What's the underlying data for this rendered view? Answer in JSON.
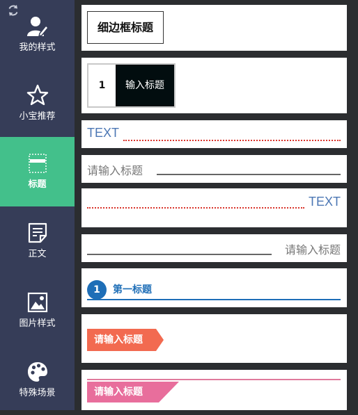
{
  "sidebar": {
    "refresh_icon": "refresh-icon",
    "items": [
      {
        "label": "我的样式",
        "icon": "user-edit-icon"
      },
      {
        "label": "小宝推荐",
        "icon": "star-icon"
      },
      {
        "label": "标题",
        "icon": "title-frame-icon",
        "active": true
      },
      {
        "label": "正文",
        "icon": "document-icon"
      },
      {
        "label": "图片样式",
        "icon": "image-icon"
      },
      {
        "label": "特殊场景",
        "icon": "palette-icon"
      }
    ],
    "colors": {
      "background": "#363d58",
      "active": "#43c08b"
    }
  },
  "styles": {
    "s1": {
      "text": "细边框标题"
    },
    "s2": {
      "number": "1",
      "text": "输入标题"
    },
    "s3": {
      "text": "TEXT"
    },
    "s4": {
      "text": "请输入标题"
    },
    "s5": {
      "text": "TEXT"
    },
    "s6": {
      "text": "请输入标题"
    },
    "s7": {
      "number": "1",
      "text": "第一标题"
    },
    "s8": {
      "text": "请输入标题"
    },
    "s9": {
      "text": "请输入标题"
    }
  },
  "colors": {
    "blue_text": "#4c77b4",
    "red_dotted": "#d9342b",
    "deep_blue": "#1e6eb7",
    "orange_tag": "#f26a50",
    "pink_tag": "#e86e9c"
  }
}
